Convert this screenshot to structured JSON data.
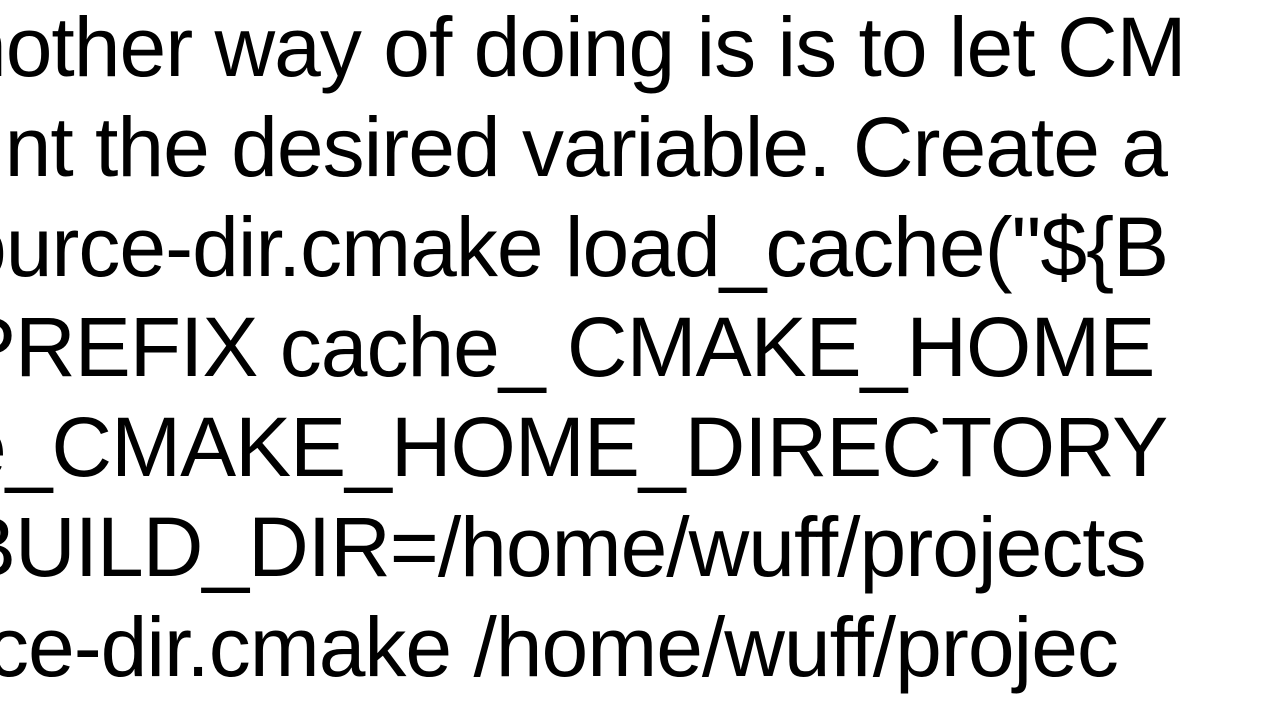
{
  "lines": {
    "l1": "nother way of doing is is to let CM",
    "l2": "rint the desired variable. Create a",
    "l3": "ource-dir.cmake load_cache(\"${B",
    "l4": "PREFIX cache_ CMAKE_HOME",
    "l5": "e_CMAKE_HOME_DIRECTORY",
    "l6": "BUILD_DIR=/home/wuff/projects",
    "l7": "rce-dir.cmake  /home/wuff/projec"
  }
}
